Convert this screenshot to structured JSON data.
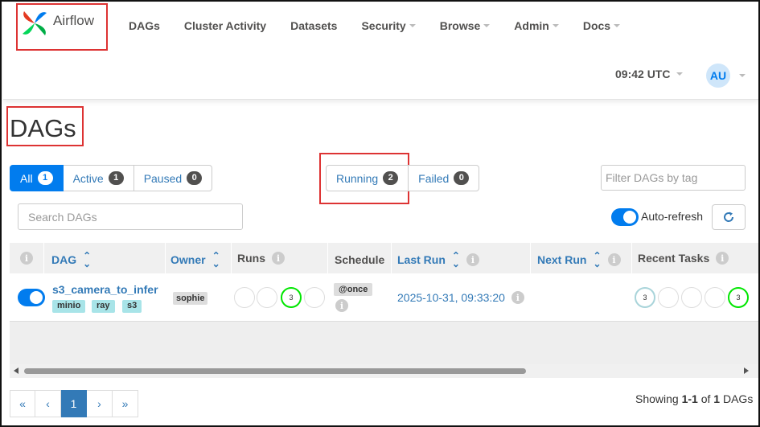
{
  "brand": {
    "name": "Airflow"
  },
  "nav": {
    "items": [
      {
        "label": "DAGs",
        "dropdown": false
      },
      {
        "label": "Cluster Activity",
        "dropdown": false
      },
      {
        "label": "Datasets",
        "dropdown": false
      },
      {
        "label": "Security",
        "dropdown": true
      },
      {
        "label": "Browse",
        "dropdown": true
      },
      {
        "label": "Admin",
        "dropdown": true
      },
      {
        "label": "Docs",
        "dropdown": true
      }
    ],
    "time": "09:42 UTC",
    "avatar": "AU"
  },
  "page": {
    "title": "DAGs"
  },
  "filters": {
    "all": {
      "label": "All",
      "count": "1"
    },
    "active": {
      "label": "Active",
      "count": "1"
    },
    "paused": {
      "label": "Paused",
      "count": "0"
    },
    "running": {
      "label": "Running",
      "count": "2"
    },
    "failed": {
      "label": "Failed",
      "count": "0"
    },
    "tag_placeholder": "Filter DAGs by tag",
    "search_placeholder": "Search DAGs",
    "autorefresh": "Auto-refresh"
  },
  "table": {
    "headers": {
      "dag": "DAG",
      "owner": "Owner",
      "runs": "Runs",
      "schedule": "Schedule",
      "last_run": "Last Run",
      "next_run": "Next Run",
      "recent_tasks": "Recent Tasks"
    },
    "row": {
      "dag_id": "s3_camera_to_infer",
      "tags": [
        "minio",
        "ray",
        "s3"
      ],
      "owner": "sophie",
      "runs": [
        "",
        "",
        "3",
        ""
      ],
      "schedule": "@once",
      "last_run": "2025-10-31, 09:33:20",
      "recent_tasks": [
        "3",
        "",
        "",
        "",
        "3"
      ]
    }
  },
  "pagination": {
    "first": "«",
    "prev": "‹",
    "page": "1",
    "next": "›",
    "last": "»",
    "showing_prefix": "Showing ",
    "range": "1-1",
    "of": " of ",
    "total": "1",
    "suffix": " DAGs"
  },
  "colors": {
    "accent": "#017cee",
    "running": "#00e600",
    "queued": "#a9d4da",
    "annotation": "#d33333"
  }
}
